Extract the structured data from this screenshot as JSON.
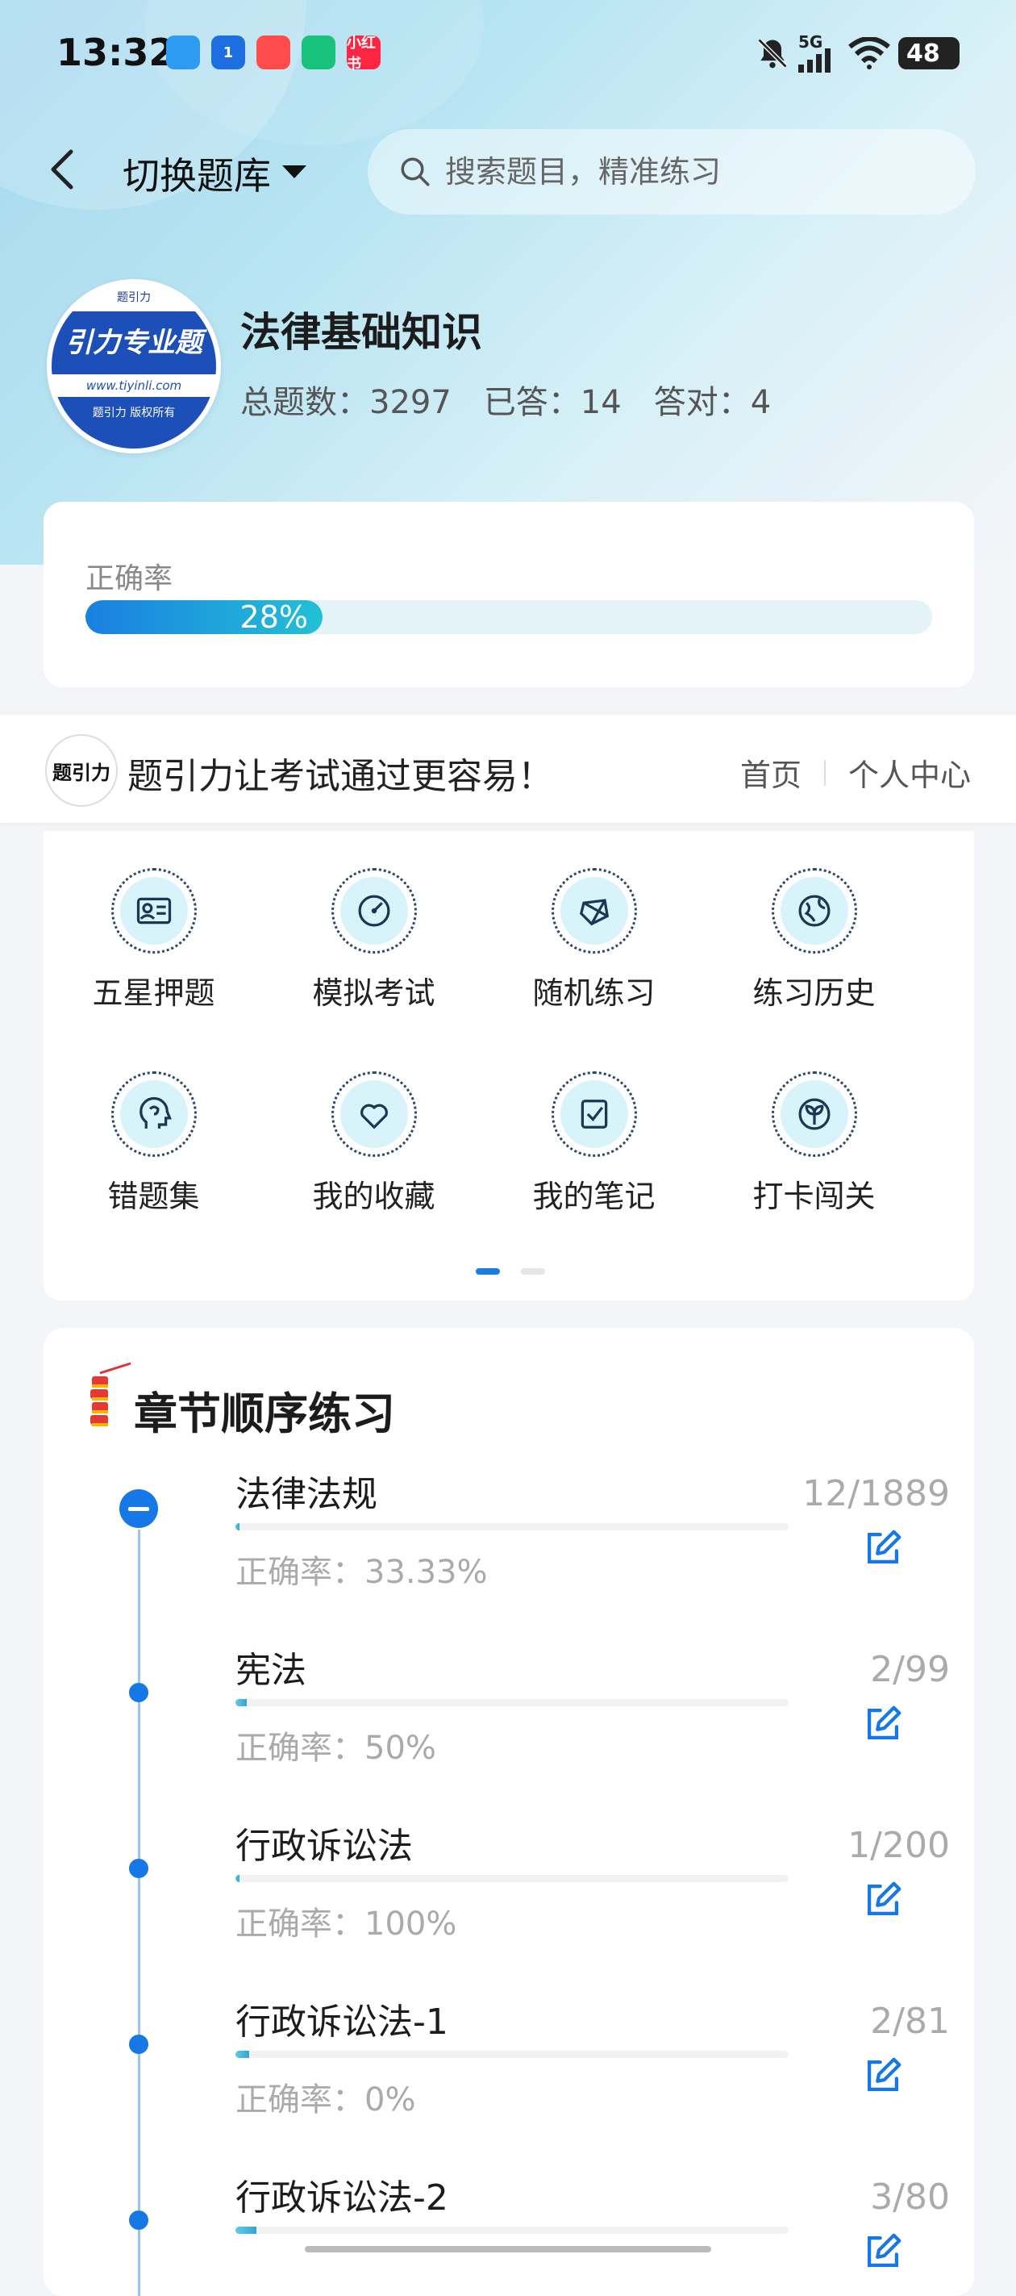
{
  "status": {
    "time": "13:32",
    "network": "5G",
    "battery": "48",
    "app_icons": [
      {
        "name": "message-app-icon",
        "text": "",
        "color": "#2f9bf0"
      },
      {
        "name": "hotspot-app-icon",
        "text": "1",
        "color": "#1d6fe0"
      },
      {
        "name": "pdd-app-icon",
        "text": "",
        "color": "#ff4b4b"
      },
      {
        "name": "green-app-icon",
        "text": "",
        "color": "#19c27b"
      },
      {
        "name": "xiaohongshu-app-icon",
        "text": "小红书",
        "color": "#ff2442"
      }
    ]
  },
  "header": {
    "switch_label": "切换题库",
    "search_placeholder": "搜索题目，精准练习"
  },
  "bank": {
    "logo_top": "题引力",
    "logo_main": "引力专业题",
    "logo_url": "www.tiyinli.com",
    "logo_bottom": "题引力 版权所有",
    "title": "法律基础知识",
    "total": "总题数：3297",
    "answered": "已答：14",
    "correct": "答对：4"
  },
  "accuracy": {
    "label": "正确率",
    "value_text": "28%",
    "fraction": 0.28,
    "color_start": "#1a7fe0",
    "color_end": "#23c0d6"
  },
  "banner": {
    "logo_text": "题引力",
    "slogan": "题引力让考试通过更容易！",
    "link_home": "首页",
    "link_profile": "个人中心"
  },
  "features": [
    {
      "label": "五星押题",
      "icon": "id-card-icon"
    },
    {
      "label": "模拟考试",
      "icon": "speedometer-icon"
    },
    {
      "label": "随机练习",
      "icon": "network-icon"
    },
    {
      "label": "练习历史",
      "icon": "globe-icon"
    },
    {
      "label": "错题集",
      "icon": "head-icon"
    },
    {
      "label": "我的收藏",
      "icon": "heart-icon"
    },
    {
      "label": "我的笔记",
      "icon": "note-check-icon"
    },
    {
      "label": "打卡闯关",
      "icon": "leaf-icon"
    }
  ],
  "chapters": {
    "title": "章节顺序练习",
    "items": [
      {
        "title": "法律法规",
        "rate": "正确率：33.33%",
        "count": "12/1889",
        "progress": 0.0064
      },
      {
        "title": "宪法",
        "rate": "正确率：50%",
        "count": "2/99",
        "progress": 0.02
      },
      {
        "title": "行政诉讼法",
        "rate": "正确率：100%",
        "count": "1/200",
        "progress": 0.005
      },
      {
        "title": "行政诉讼法-1",
        "rate": "正确率：0%",
        "count": "2/81",
        "progress": 0.025
      },
      {
        "title": "行政诉讼法-2",
        "rate": "",
        "count": "3/80",
        "progress": 0.0375
      }
    ]
  }
}
